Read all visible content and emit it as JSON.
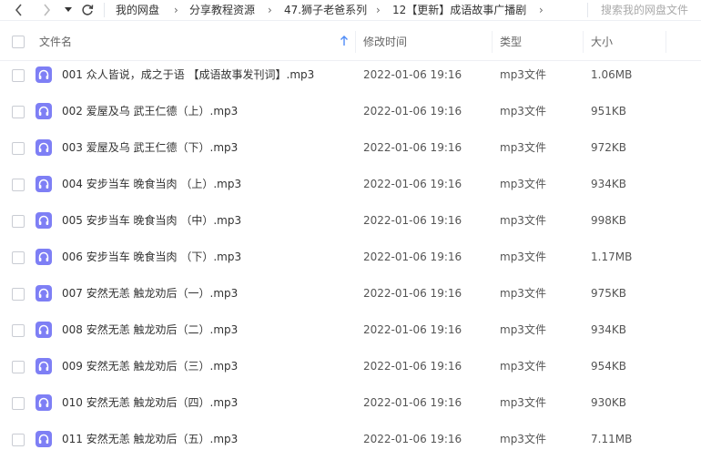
{
  "toolbar": {
    "breadcrumbs": [
      "我的网盘",
      "分享教程资源",
      "47.狮子老爸系列",
      "12【更新】成语故事广播剧"
    ],
    "search_placeholder": "搜索我的网盘文件"
  },
  "table": {
    "headers": {
      "name": "文件名",
      "modified": "修改时间",
      "type": "类型",
      "size": "大小"
    },
    "rows": [
      {
        "name": "001 众人皆说，成之于语 【成语故事发刊词】.mp3",
        "modified": "2022-01-06 19:16",
        "type": "mp3文件",
        "size": "1.06MB"
      },
      {
        "name": "002 爱屋及乌 武王仁德（上）.mp3",
        "modified": "2022-01-06 19:16",
        "type": "mp3文件",
        "size": "951KB"
      },
      {
        "name": "003 爱屋及乌 武王仁德（下）.mp3",
        "modified": "2022-01-06 19:16",
        "type": "mp3文件",
        "size": "972KB"
      },
      {
        "name": "004 安步当车 晚食当肉 （上）.mp3",
        "modified": "2022-01-06 19:16",
        "type": "mp3文件",
        "size": "934KB"
      },
      {
        "name": "005 安步当车 晚食当肉 （中）.mp3",
        "modified": "2022-01-06 19:16",
        "type": "mp3文件",
        "size": "998KB"
      },
      {
        "name": "006 安步当车 晚食当肉 （下）.mp3",
        "modified": "2022-01-06 19:16",
        "type": "mp3文件",
        "size": "1.17MB"
      },
      {
        "name": "007 安然无恙 触龙劝后（一）.mp3",
        "modified": "2022-01-06 19:16",
        "type": "mp3文件",
        "size": "975KB"
      },
      {
        "name": "008 安然无恙 触龙劝后（二）.mp3",
        "modified": "2022-01-06 19:16",
        "type": "mp3文件",
        "size": "934KB"
      },
      {
        "name": "009 安然无恙 触龙劝后（三）.mp3",
        "modified": "2022-01-06 19:16",
        "type": "mp3文件",
        "size": "954KB"
      },
      {
        "name": "010 安然无恙 触龙劝后（四）.mp3",
        "modified": "2022-01-06 19:16",
        "type": "mp3文件",
        "size": "930KB"
      },
      {
        "name": "011 安然无恙 触龙劝后（五）.mp3",
        "modified": "2022-01-06 19:16",
        "type": "mp3文件",
        "size": "7.11MB"
      }
    ]
  },
  "colors": {
    "audio_icon": "#7e7ff5",
    "sort_arrow": "#4e8cf7"
  },
  "icons": {
    "back": "chevron-left-icon",
    "forward": "chevron-right-icon",
    "dropdown": "caret-down-icon",
    "refresh": "refresh-icon",
    "file": "headphones-icon",
    "sort": "arrow-up-icon"
  }
}
